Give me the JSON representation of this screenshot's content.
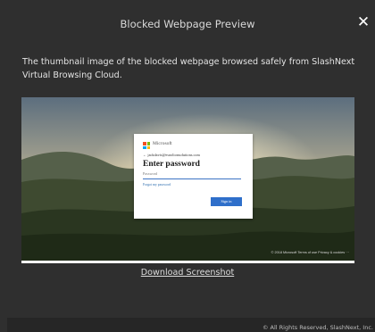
{
  "modal": {
    "title": "Blocked Webpage Preview",
    "close_label": "✕",
    "description": "The thumbnail image of the blocked webpage browsed safely from SlashNext Virtual Browsing Cloud.",
    "download_label": "Download Screenshot",
    "copyright": "© All Rights Reserved, SlashNext, Inc."
  },
  "preview": {
    "brand": "Microsoft",
    "email": "← jackdavis@eurolionsolutions.com",
    "heading": "Enter password",
    "password_placeholder": "Password",
    "forgot_link": "Forgot my password",
    "signin_label": "Sign in",
    "footer": "© 2018 Microsoft   Terms of use   Privacy & cookies   ···"
  },
  "colors": {
    "modal_bg": "#2f2f2f",
    "signin_button": "#2f6fca",
    "logo": [
      "#f25022",
      "#7fba00",
      "#00a4ef",
      "#ffb900"
    ]
  }
}
